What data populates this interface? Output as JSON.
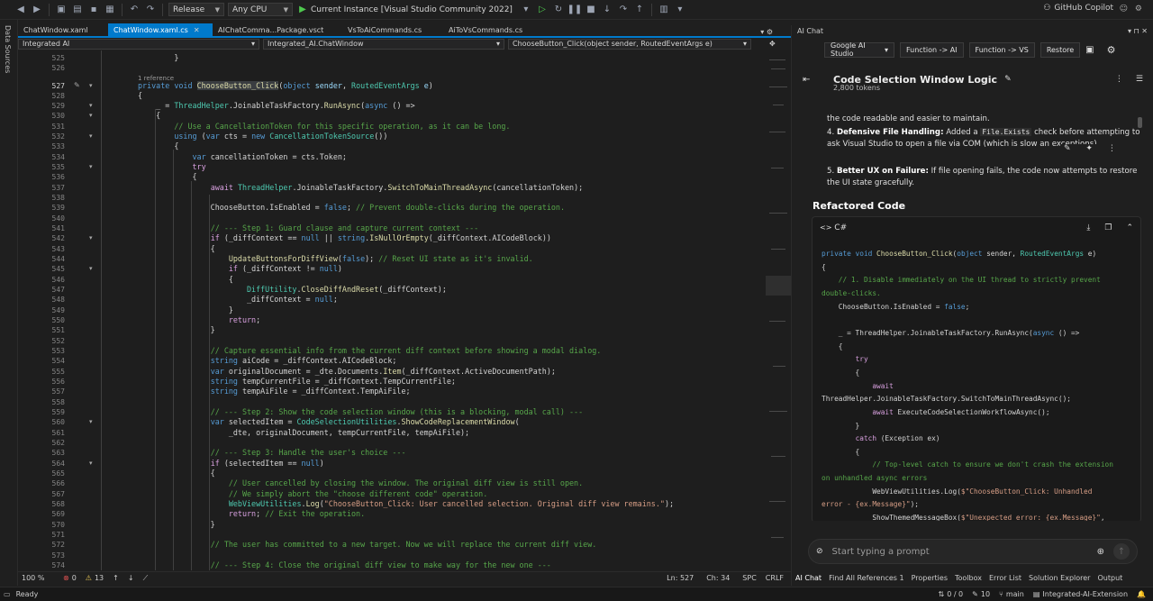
{
  "toolbar": {
    "config": "Release",
    "platform": "Any CPU",
    "run_target": "Current Instance [Visual Studio Community 2022]",
    "copilot": "GitHub Copilot"
  },
  "left_strip": {
    "label": "Data Sources"
  },
  "tabs": [
    {
      "label": "ChatWindow.xaml",
      "active": false
    },
    {
      "label": "ChatWindow.xaml.cs",
      "active": true
    },
    {
      "label": "AIChatComma...Package.vsct",
      "active": false
    },
    {
      "label": "VsToAiCommands.cs",
      "active": false
    },
    {
      "label": "AiToVsCommands.cs",
      "active": false
    }
  ],
  "nav": {
    "project": "Integrated AI",
    "class": "Integrated_AI.ChatWindow",
    "member": "ChooseButton_Click(object sender, RoutedEventArgs e)"
  },
  "editor": {
    "reference": "1 reference",
    "zoom": "100 %",
    "errors": "0",
    "warnings": "13",
    "ln": "Ln: 527",
    "ch": "Ch: 34",
    "spc": "SPC",
    "crlf": "CRLF"
  },
  "chat": {
    "panel_title": "AI Chat",
    "provider": "Google AI Studio",
    "btn_fn_ai": "Function -> AI",
    "btn_fn_vs": "Function -> VS",
    "btn_restore": "Restore",
    "conversation_title": "Code Selection Window Logic",
    "tokens": "2,800 tokens",
    "p0": "the code readable and easier to maintain.",
    "item4_n": "4.",
    "item4_bold": "Defensive File Handling:",
    "item4_a": " Added a ",
    "item4_code": "File.Exists",
    "item4_b": " check before attempting to ask Visual Studio to open a file via COM (which is slow an",
    "item4_c": "exceptions).",
    "item5_n": "5.",
    "item5_bold": "Better UX on Failure:",
    "item5_a": " If file opening fails, the code now attempts to restore the UI state gracefully.",
    "refactored": "Refactored Code",
    "lang": "C#",
    "input_placeholder": "Start typing a prompt",
    "bottom_tabs": [
      "AI Chat",
      "Find All References 1",
      "Properties",
      "Toolbox",
      "Error List",
      "Solution Explorer",
      "Output"
    ]
  },
  "status": {
    "ready": "Ready",
    "changes": "0 / 0",
    "edits": "10",
    "branch": "main",
    "repo": "Integrated-AI-Extension"
  }
}
